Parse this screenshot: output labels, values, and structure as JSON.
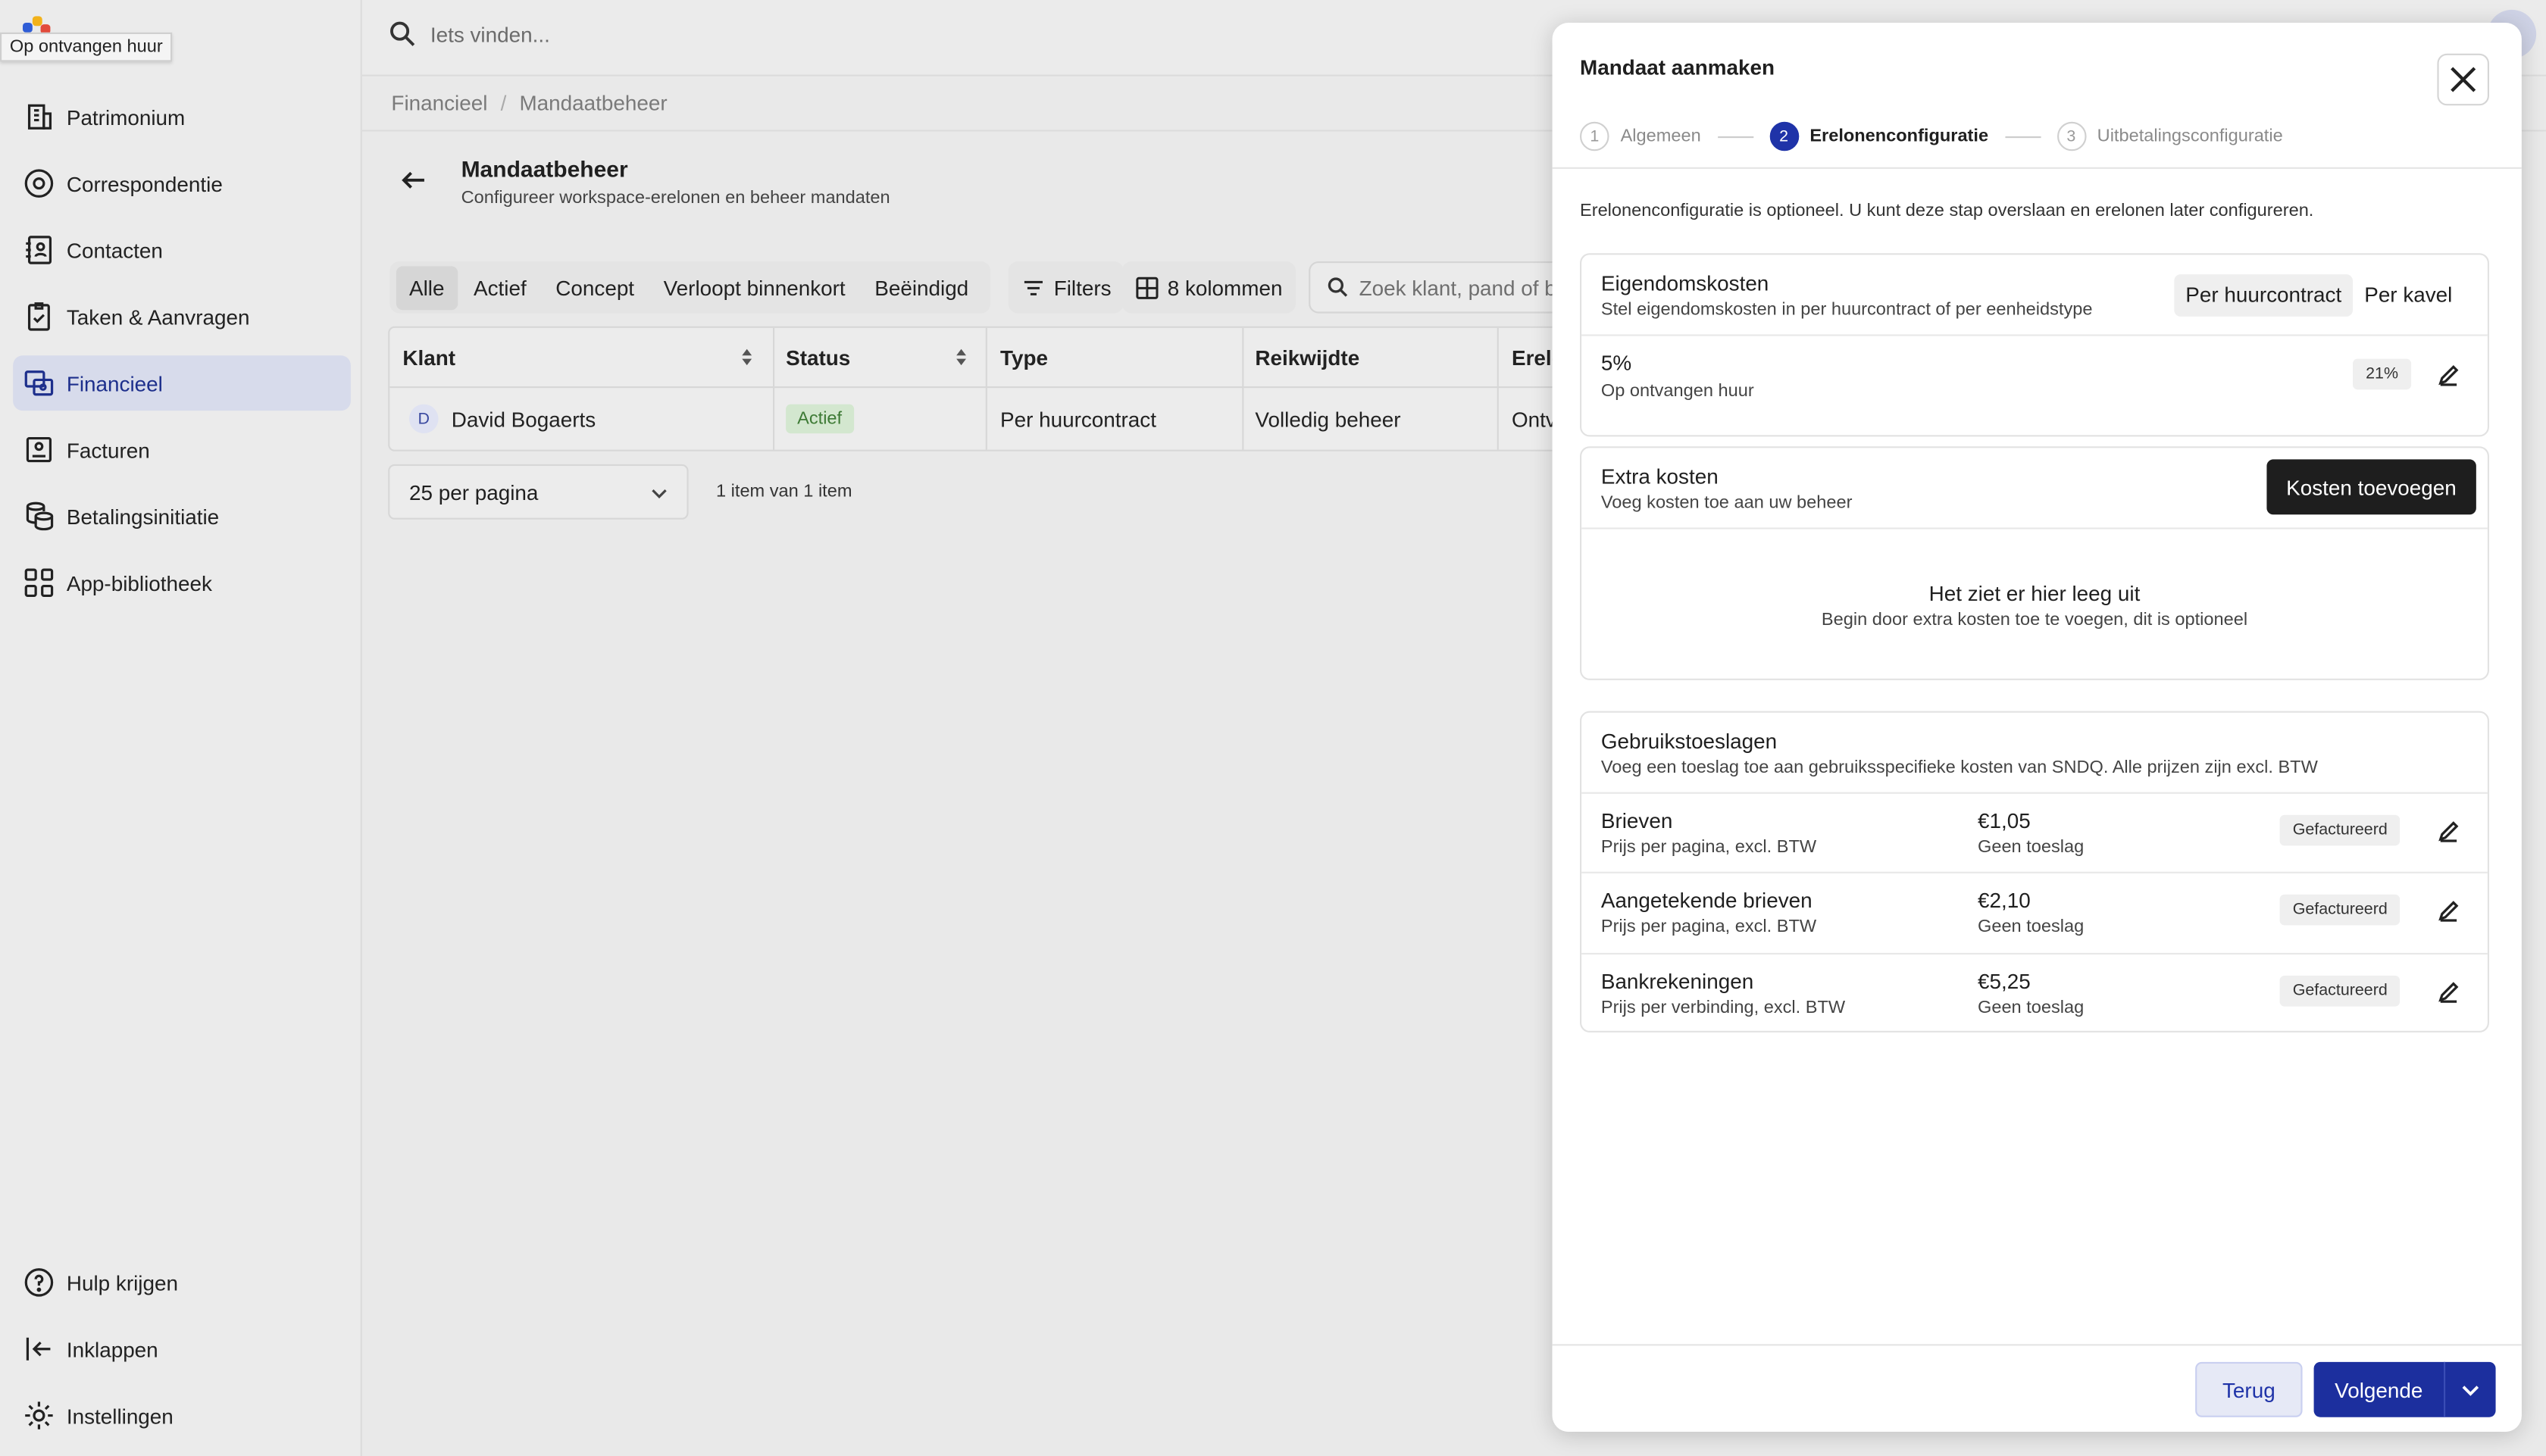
{
  "tooltip": "Op ontvangen huur",
  "brand": {
    "colors": [
      "#f2b21b",
      "#2f5dd6",
      "#e24a3b"
    ]
  },
  "sidebar": {
    "items": [
      {
        "label": "Patrimonium",
        "icon": "building-icon"
      },
      {
        "label": "Correspondentie",
        "icon": "mail-circle-icon"
      },
      {
        "label": "Contacten",
        "icon": "contacts-book-icon"
      },
      {
        "label": "Taken & Aanvragen",
        "icon": "clipboard-check-icon"
      },
      {
        "label": "Financieel",
        "icon": "finance-icon",
        "active": true
      },
      {
        "label": "Facturen",
        "icon": "invoice-icon"
      },
      {
        "label": "Betalingsinitiatie",
        "icon": "coins-stack-icon"
      },
      {
        "label": "App-bibliotheek",
        "icon": "app-grid-icon"
      }
    ],
    "bottom": [
      {
        "label": "Hulp krijgen",
        "icon": "help-circle-icon"
      },
      {
        "label": "Inklappen",
        "icon": "collapse-left-icon"
      },
      {
        "label": "Instellingen",
        "icon": "gear-icon"
      }
    ]
  },
  "topbar": {
    "search_placeholder": "Iets vinden..."
  },
  "breadcrumb": [
    "Financieel",
    "Mandaatbeheer"
  ],
  "page": {
    "title": "Mandaatbeheer",
    "subtitle": "Configureer workspace-erelonen en beheer mandaten"
  },
  "filters": {
    "tabs": [
      "Alle",
      "Actief",
      "Concept",
      "Verloopt binnenkort",
      "Beëindigd"
    ],
    "active_tab": "Alle",
    "filters_label": "Filters",
    "columns_label": "8 kolommen",
    "search_placeholder": "Zoek klant, pand of b"
  },
  "table": {
    "headers": [
      "Klant",
      "Status",
      "Type",
      "Reikwijdte",
      "Erelo"
    ],
    "rows": [
      {
        "initial": "D",
        "klant": "David Bogaerts",
        "status": "Actief",
        "type": "Per huurcontract",
        "reikwijdte": "Volledig beheer",
        "erelonen": "Ontv"
      }
    ]
  },
  "pagination": {
    "per_page": "25 per pagina",
    "info": "1 item van 1 item"
  },
  "modal": {
    "title": "Mandaat aanmaken",
    "steps": [
      {
        "num": "1",
        "label": "Algemeen"
      },
      {
        "num": "2",
        "label": "Erelonenconfiguratie",
        "active": true
      },
      {
        "num": "3",
        "label": "Uitbetalingsconfiguratie"
      }
    ],
    "note": "Erelonenconfiguratie is optioneel. U kunt deze stap overslaan en erelonen later configureren.",
    "ownership": {
      "title": "Eigendomskosten",
      "subtitle": "Stel eigendomskosten in per huurcontract of per eenheidstype",
      "options": [
        "Per huurcontract",
        "Per kavel"
      ],
      "selected": "Per huurcontract",
      "value": "5%",
      "value_sub": "Op ontvangen huur",
      "vat": "21%"
    },
    "extra": {
      "title": "Extra kosten",
      "subtitle": "Voeg kosten toe aan uw beheer",
      "button": "Kosten toevoegen",
      "empty_title": "Het ziet er hier leeg uit",
      "empty_sub": "Begin door extra kosten toe te voegen, dit is optioneel"
    },
    "usage": {
      "title": "Gebruikstoeslagen",
      "subtitle": "Voeg een toeslag toe aan gebruiksspecifieke kosten van SNDQ. Alle prijzen zijn excl. BTW",
      "rows": [
        {
          "name": "Brieven",
          "desc": "Prijs per pagina, excl. BTW",
          "price": "€1,05",
          "surcharge": "Geen toeslag",
          "status": "Gefactureerd"
        },
        {
          "name": "Aangetekende brieven",
          "desc": "Prijs per pagina, excl. BTW",
          "price": "€2,10",
          "surcharge": "Geen toeslag",
          "status": "Gefactureerd"
        },
        {
          "name": "Bankrekeningen",
          "desc": "Prijs per verbinding, excl. BTW",
          "price": "€5,25",
          "surcharge": "Geen toeslag",
          "status": "Gefactureerd"
        }
      ]
    },
    "footer": {
      "back": "Terug",
      "next": "Volgende"
    }
  }
}
